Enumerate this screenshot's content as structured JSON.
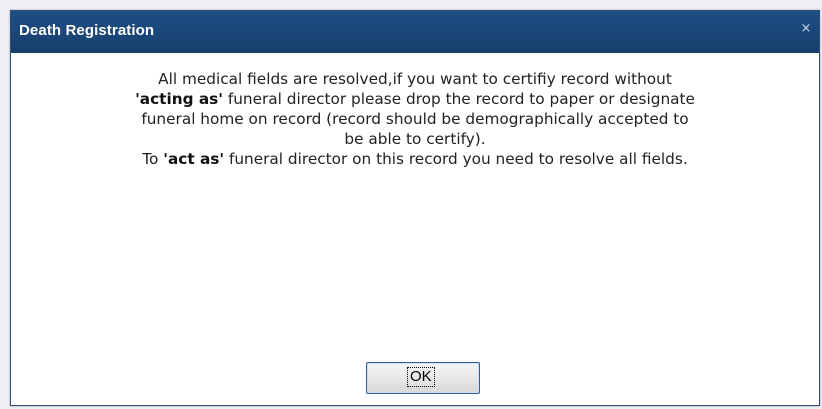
{
  "dialog": {
    "title": "Death Registration",
    "close_glyph": "×",
    "message": {
      "line1": "All medical fields are resolved,if you want to certifiy record without",
      "line2_bold": "'acting as'",
      "line2_rest": " funeral director please drop the record to paper or designate",
      "line3": "funeral home on record (record should be demographically accepted to",
      "line4": "be able to certify).",
      "line5_pre": "To ",
      "line5_bold": "'act as'",
      "line5_rest": " funeral director on this record you need to resolve all fields."
    },
    "ok_label": "OK"
  },
  "colors": {
    "titlebar": "#1f4f86",
    "title_text": "#ffffff",
    "body_bg": "#ffffff",
    "button_border": "#2f5e9a"
  }
}
